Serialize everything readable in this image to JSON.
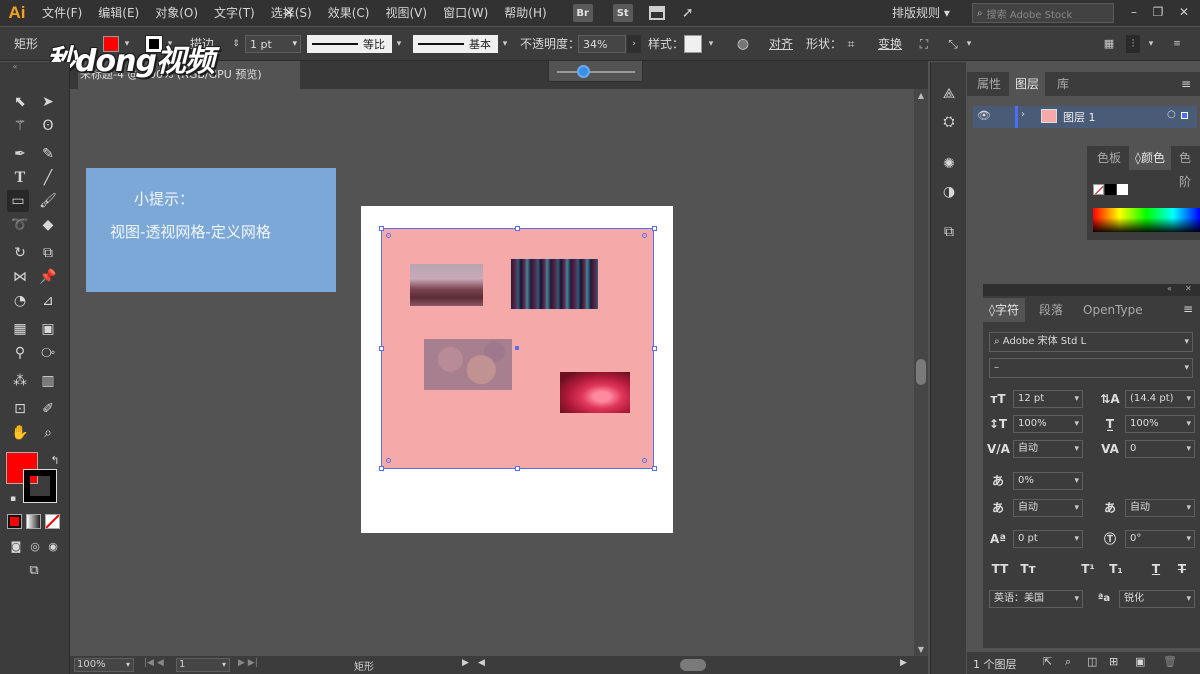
{
  "app": {
    "logo": "Ai"
  },
  "menu": [
    "文件(F)",
    "编辑(E)",
    "对象(O)",
    "文字(T)",
    "选择(S)",
    "效果(C)",
    "视图(V)",
    "窗口(W)",
    "帮助(H)"
  ],
  "menu_badges": [
    "Br",
    "St"
  ],
  "workspace": "排版规则",
  "search_placeholder": "搜索 Adobe Stock",
  "control": {
    "shape_label": "矩形",
    "stroke_label": "描边",
    "stroke_weight": "1 pt",
    "profile_label": "等比",
    "brush_label": "基本",
    "opacity_label": "不透明度：",
    "opacity_value": "34%",
    "style_label": "样式：",
    "align_label": "对齐",
    "shape_props_label": "形状：",
    "transform_label": "变换"
  },
  "watermark": "秒dong视频",
  "document": {
    "tab_title": "未标题-4 @ 100% (RGB/GPU 预览)"
  },
  "opacity_slider_fraction": 0.34,
  "tip": {
    "title": "小提示：",
    "body": "视图-透视网格-定义网格"
  },
  "status": {
    "zoom": "100%",
    "page": "1",
    "tool": "矩形"
  },
  "layers_panel": {
    "tabs": [
      "属性",
      "图层",
      "库"
    ],
    "active_tab": "图层",
    "layer_name": "图层 1",
    "footer_count": "1 个图层"
  },
  "color_panel": {
    "tabs": [
      "色板",
      "颜色",
      "色阶"
    ],
    "active_tab": "颜色"
  },
  "character_panel": {
    "tabs": [
      "字符",
      "段落",
      "OpenType"
    ],
    "font_family": "Adobe 宋体 Std L",
    "font_style": "–",
    "font_size": "12 pt",
    "leading": "(14.4 pt)",
    "vert_scale": "100%",
    "horiz_scale": "100%",
    "kerning": "自动",
    "tracking": "0",
    "tsume": "0%",
    "aki_left": "自动",
    "aki_right": "自动",
    "baseline": "0 pt",
    "rotation": "0°",
    "language": "英语：美国",
    "antialias": "锐化"
  },
  "colors": {
    "fill": "#ff0000",
    "rect": "#f5a9a8",
    "tip_box": "#7ca8d8",
    "selection": "#5a6ee8"
  }
}
